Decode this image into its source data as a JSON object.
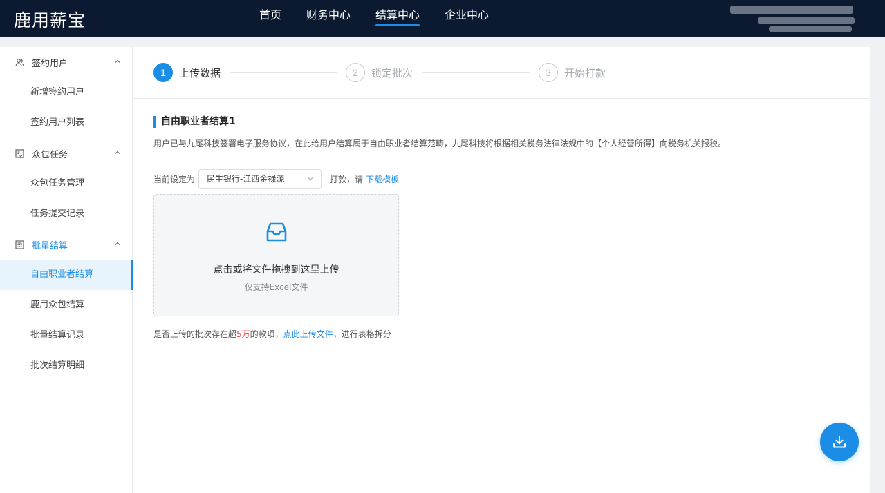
{
  "app": {
    "logo": "鹿用薪宝"
  },
  "topnav": {
    "items": [
      {
        "label": "首页",
        "active": false
      },
      {
        "label": "财务中心",
        "active": false
      },
      {
        "label": "结算中心",
        "active": true
      },
      {
        "label": "企业中心",
        "active": false
      }
    ]
  },
  "sidebar": {
    "groups": [
      {
        "label": "签约用户",
        "icon": "users-icon",
        "items": [
          "新增签约用户",
          "签约用户列表"
        ]
      },
      {
        "label": "众包任务",
        "icon": "task-icon",
        "items": [
          "众包任务管理",
          "任务提交记录"
        ]
      },
      {
        "label": "批量结算",
        "icon": "calculator-icon",
        "items": [
          "自由职业者结算",
          "鹿用众包结算",
          "批量结算记录",
          "批次结算明细"
        ],
        "active": true
      }
    ],
    "active_item": "自由职业者结算"
  },
  "steps": [
    {
      "num": "1",
      "label": "上传数据",
      "active": true
    },
    {
      "num": "2",
      "label": "锁定批次",
      "active": false
    },
    {
      "num": "3",
      "label": "开始打款",
      "active": false
    }
  ],
  "section": {
    "title": "自由职业者结算1",
    "description": "用户已与九尾科技签署电子服务协议，在此给用户结算属于自由职业者结算范畴，九尾科技将根据相关税务法律法规中的【个人经营所得】向税务机关报税。"
  },
  "setting": {
    "prefix": "当前设定为",
    "selected": "民生银行-江西金禄源",
    "middle": "打款，请",
    "link": "下载模板"
  },
  "upload": {
    "main_text": "点击或将文件拖拽到这里上传",
    "sub_text": "仅支持Excel文件"
  },
  "split": {
    "text1": "是否上传的批次存在超",
    "highlight": "5万",
    "text2": "的款项，",
    "link": "点此上传文件",
    "text3": "，进行表格拆分"
  },
  "colors": {
    "accent": "#1c8de4",
    "topbar": "#0b1a30",
    "highlight_red": "#f0403c"
  }
}
